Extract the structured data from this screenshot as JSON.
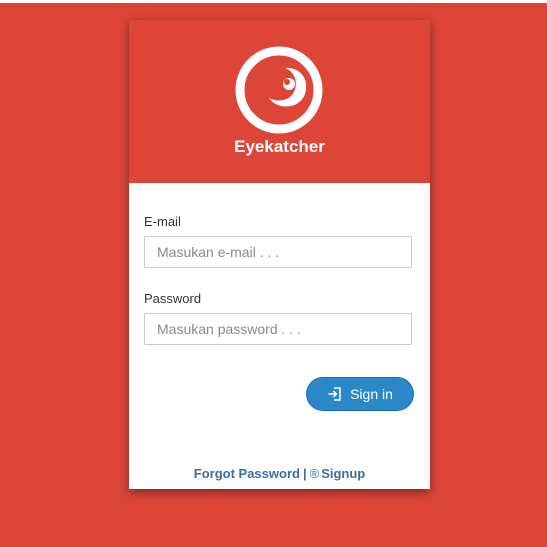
{
  "app": {
    "brand": "Eyekatcher",
    "logo_icon": "eye-logo-icon"
  },
  "form": {
    "email_label": "E-mail",
    "email_placeholder": "Masukan e-mail . . .",
    "email_value": "",
    "password_label": "Password",
    "password_placeholder": "Masukan password . . .",
    "password_value": "",
    "signin_label": "Sign in",
    "signin_icon": "sign-in-icon"
  },
  "footer": {
    "forgot_label": "Forgot Password",
    "separator": "|",
    "signup_symbol": "®",
    "signup_label": "Signup"
  },
  "colors": {
    "brand_red": "#dd4539",
    "button_blue": "#2a88c9",
    "link_blue": "#3b6fa3"
  }
}
